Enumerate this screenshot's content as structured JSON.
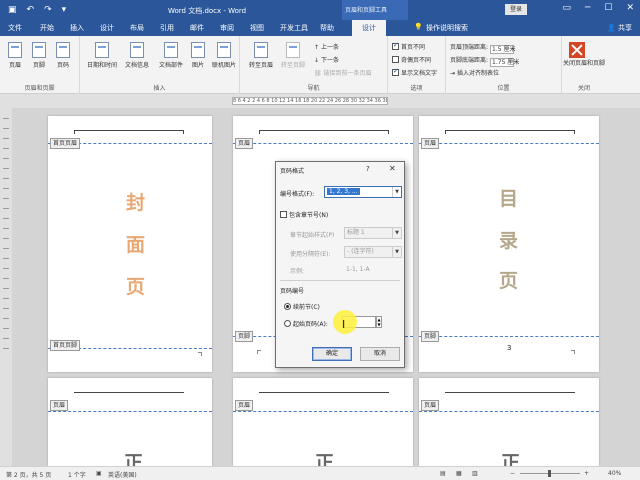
{
  "titlebar": {
    "title": "Word 文档.docx - Word",
    "context_tab_group": "页眉和页脚工具",
    "login": "登录",
    "undo_icon": "↶",
    "redo_icon": "↷"
  },
  "menu": {
    "tabs": [
      "文件",
      "开始",
      "插入",
      "设计",
      "布局",
      "引用",
      "邮件",
      "审阅",
      "视图",
      "开发工具",
      "帮助"
    ],
    "active_tab": "设计",
    "tell_me": "操作说明搜索",
    "share": "共享"
  },
  "ribbon": {
    "group_header_footer": {
      "label": "页眉和页脚",
      "header": "页眉",
      "footer": "页脚",
      "page_number": "页码"
    },
    "group_insert": {
      "label": "插入",
      "date_time": "日期和时间",
      "doc_info": "文档信息",
      "doc_parts": "文档部件",
      "picture": "图片",
      "online_picture": "联机图片"
    },
    "group_nav": {
      "label": "导航",
      "goto_header": "转至页眉",
      "goto_footer": "转至页脚",
      "previous": "上一条",
      "next": "下一条",
      "link_prev": "链接到前一条页眉"
    },
    "group_options": {
      "label": "选项",
      "first_page_diff": "首页不同",
      "odd_even_diff": "奇偶页不同",
      "show_doc_text": "显示文档文字"
    },
    "group_position": {
      "label": "位置",
      "header_top": "页眉顶端距离:",
      "header_top_value": "1.5 厘米",
      "footer_bottom": "页脚底端距离:",
      "footer_bottom_value": "1.75 厘米",
      "insert_align_tab": "插入对齐制表位"
    },
    "group_close": {
      "label": "关闭",
      "close": "关闭页眉和页脚"
    }
  },
  "ruler": {
    "text": "8 6 4 2   2 4 6 8 10 12 14 16 18 20 22 24 26 28 30 32 34 36 38 40 42"
  },
  "pages": {
    "p1": {
      "header_tag": "首页页眉",
      "footer_tag": "首页页脚",
      "chars": [
        "封",
        "面",
        "页"
      ],
      "color": "#e8a873"
    },
    "p2": {
      "header_tag": "页眉",
      "footer_tag": "页脚"
    },
    "p3": {
      "header_tag": "页眉",
      "footer_tag": "页脚",
      "chars": [
        "目",
        "录",
        "页"
      ],
      "color": "#b5a78a",
      "page_number": "3"
    },
    "row2": {
      "header_tag": "页眉",
      "char": "正",
      "color": "#666666"
    }
  },
  "dialog": {
    "title": "页码格式",
    "help": "?",
    "close": "✕",
    "number_format_label": "编号格式(F):",
    "number_format_value": "1, 2, 3, ...",
    "include_chapter": "包含章节号(N)",
    "chapter_style_label": "章节起始样式(P)",
    "chapter_style_value": "标题 1",
    "separator_label": "使用分隔符(E):",
    "separator_value": "- (连字符)",
    "example_label": "示例:",
    "example_value": "1-1, 1-A",
    "numbering_label": "页码编号",
    "continue_prev": "续前节(C)",
    "start_at": "起始页码(A):",
    "start_at_value": "",
    "ok": "确定",
    "cancel": "取消"
  },
  "status": {
    "page": "第 2 页，共 5 页",
    "words": "1 个字",
    "lang": "英语(美国)",
    "zoom": "40%",
    "minus": "−",
    "plus": "+"
  }
}
